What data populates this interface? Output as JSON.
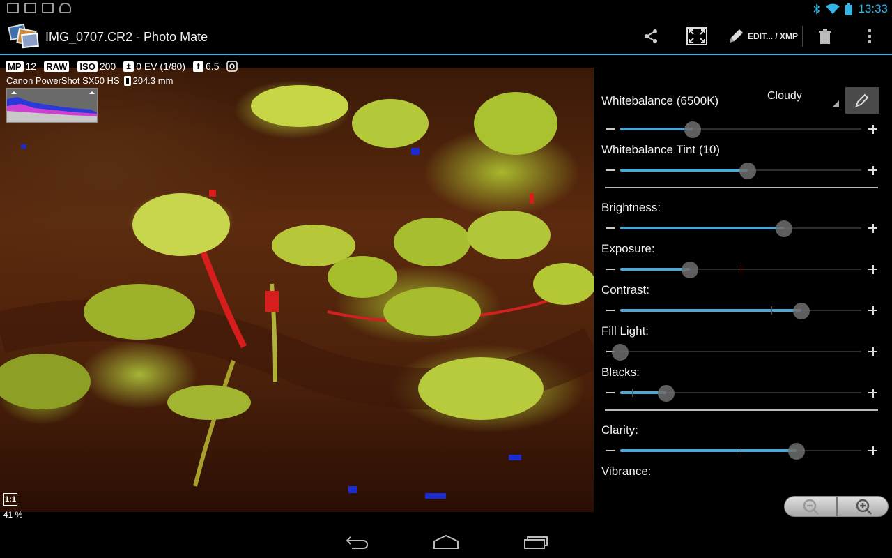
{
  "status_bar": {
    "time": "13:33",
    "notification_icons": [
      "image-icon",
      "mail-icon",
      "gmail-icon",
      "android-icon"
    ],
    "system_icons": [
      "bluetooth-icon",
      "wifi-icon",
      "battery-icon"
    ],
    "accent_color": "#33b5e5"
  },
  "action_bar": {
    "title": "IMG_0707.CR2 - Photo Mate",
    "edit_label": "EDIT... / XMP",
    "icons": [
      "share-icon",
      "fullscreen-icon",
      "pencil-icon",
      "trash-icon",
      "overflow-menu-icon"
    ]
  },
  "photo_info": {
    "mp_badge": "MP",
    "mp_value": "12",
    "raw_badge": "RAW",
    "iso_badge": "ISO",
    "iso_value": "200",
    "ev_value": "0 EV (1/80)",
    "f_badge": "f",
    "aperture_value": "6.5",
    "camera": "Canon PowerShot SX50 HS",
    "focal_length": "204.3 mm"
  },
  "zoom": {
    "one_to_one": "1:1",
    "percent": "41 %"
  },
  "panel": {
    "whitebalance_label": "Whitebalance (6500K)",
    "whitebalance_mode": "Cloudy",
    "tint_label": "Whitebalance Tint (10)",
    "brightness_label": "Brightness:",
    "exposure_label": "Exposure:",
    "contrast_label": "Contrast:",
    "fill_light_label": "Fill Light:",
    "blacks_label": "Blacks:",
    "clarity_label": "Clarity:",
    "vibrance_label": "Vibrance:",
    "slider_levels": {
      "whitebalance": 0.3,
      "tint": 0.53,
      "brightness": 0.68,
      "exposure": 0.29,
      "contrast": 0.75,
      "fill_light": 0.0,
      "blacks": 0.19,
      "clarity": 0.73
    },
    "slider_color": "#4da8d6"
  },
  "nav_bar": {
    "icons": [
      "back-icon",
      "home-icon",
      "recent-apps-icon"
    ]
  }
}
